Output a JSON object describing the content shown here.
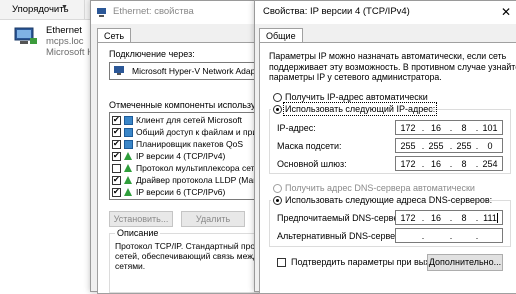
{
  "explorer": {
    "organize_label": "Упорядочить",
    "adapter_name": "Ethernet",
    "adapter_network": "mcps.loc",
    "adapter_device": "Microsoft Hy"
  },
  "eth_props": {
    "title": "Ethernet: свойства",
    "tab": "Сеть",
    "connect_via_label": "Подключение через:",
    "adapter_name": "Microsoft Hyper-V Network Adapter",
    "components_label": "Отмеченные компоненты используются эт",
    "components": [
      {
        "label": "Клиент для сетей Microsoft",
        "checked": true,
        "icon": "network-icon"
      },
      {
        "label": "Общий доступ к файлам и принтер",
        "checked": true,
        "icon": "network-icon"
      },
      {
        "label": "Планировщик пакетов QoS",
        "checked": true,
        "icon": "network-icon"
      },
      {
        "label": "IP версии 4 (TCP/IPv4)",
        "checked": true,
        "icon": "protocol-icon"
      },
      {
        "label": "Протокол мультиплексора сетевог",
        "checked": false,
        "icon": "protocol-icon"
      },
      {
        "label": "Драйвер протокола LLDP (Майкро",
        "checked": true,
        "icon": "protocol-icon"
      },
      {
        "label": "IP версии 6 (TCP/IPv6)",
        "checked": true,
        "icon": "protocol-icon"
      }
    ],
    "install_label": "Установить...",
    "remove_label": "Удалить",
    "description_title": "Описание",
    "description_text_1": "Протокол TCP/IP. Стандартный протоко",
    "description_text_2": "сетей, обеспечивающий связь между ра",
    "description_text_3": "сетями."
  },
  "ipv4": {
    "title": "Свойства: IP версии 4 (TCP/IPv4)",
    "tab": "Общие",
    "intro_1": "Параметры IP можно назначать автоматически, если сеть",
    "intro_2": "поддерживает эту возможность. В противном случае узнайте",
    "intro_3": "параметры IP у сетевого администратора.",
    "auto_ip_label": "Получить IP-адрес автоматически",
    "manual_ip_label": "Использовать следующий IP-адрес:",
    "ip_label": "IP-адрес:",
    "ip": [
      "172",
      "16",
      "8",
      "101"
    ],
    "mask_label": "Маска подсети:",
    "mask": [
      "255",
      "255",
      "255",
      "0"
    ],
    "gateway_label": "Основной шлюз:",
    "gateway": [
      "172",
      "16",
      "8",
      "254"
    ],
    "auto_dns_label": "Получить адрес DNS-сервера автоматически",
    "manual_dns_label": "Использовать следующие адреса DNS-серверов:",
    "preferred_dns_label": "Предпочитаемый DNS-сервер:",
    "preferred_dns": [
      "172",
      "16",
      "8",
      "111"
    ],
    "alt_dns_label": "Альтернативный DNS-сервер:",
    "alt_dns": [
      "",
      "",
      "",
      ""
    ],
    "validate_label": "Подтвердить параметры при выходе",
    "advanced_label": "Дополнительно..."
  }
}
